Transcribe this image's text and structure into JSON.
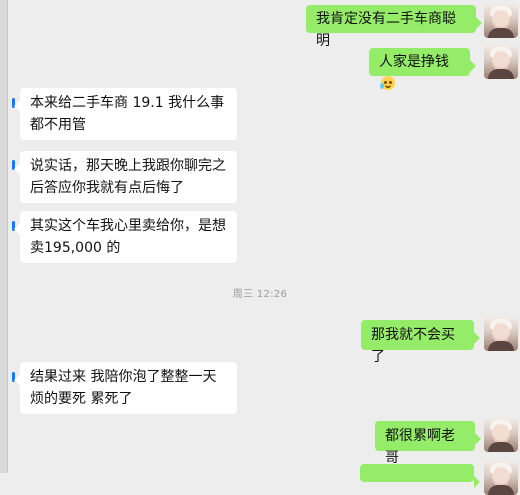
{
  "messages": [
    {
      "side": "right",
      "text": "我肯定没有二手车商聪明"
    },
    {
      "side": "right",
      "text": "人家是挣钱",
      "emoji": "crying-laughing-icon"
    },
    {
      "side": "left",
      "text": "本来给二手车商 19.1 我什么事都不用管"
    },
    {
      "side": "left",
      "text": "说实话，那天晚上我跟你聊完之后答应你我就有点后悔了"
    },
    {
      "side": "left",
      "text": "其实这个车我心里卖给你，是想卖195,000 的"
    },
    {
      "side": "right",
      "text": "那我就不会买了"
    },
    {
      "side": "left",
      "text": "结果过来 我陪你泡了整整一天 烦的要死 累死了"
    },
    {
      "side": "right",
      "text": "都很累啊老哥"
    }
  ],
  "timestamp": "周三 12:26"
}
